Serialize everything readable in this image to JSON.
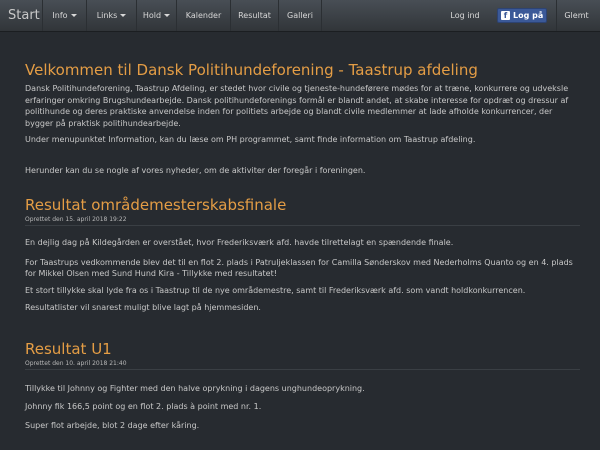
{
  "nav": {
    "brand": "Start",
    "items": [
      {
        "label": "Info",
        "dropdown": true
      },
      {
        "label": "Links",
        "dropdown": true
      },
      {
        "label": "Hold",
        "dropdown": true
      },
      {
        "label": "Kalender",
        "dropdown": false
      },
      {
        "label": "Resultat",
        "dropdown": false
      },
      {
        "label": "Galleri",
        "dropdown": false
      }
    ],
    "login": "Log ind",
    "facebook_login": "Log på",
    "forgot": "Glemt"
  },
  "welcome": {
    "title": "Velkommen til Dansk Politihundeforening - Taastrup afdeling",
    "paragraphs": [
      "Dansk Politihundeforening, Taastrup Afdeling, er stedet hvor civile og tjeneste-hundeførere mødes for at træne, konkurrere og udveksle erfaringer omkring Brugshundearbejde. Dansk politihundeforenings formål er blandt andet, at skabe interesse for opdræt og dressur af politihunde og deres praktiske anvendelse inden for politiets arbejde og blandt civile medlemmer at lade afholde konkurrencer, der bygger på praktisk politihundearbejde.",
      "Under menupunktet Information, kan du læse om PH programmet, samt finde information om Taastrup afdeling.",
      "Herunder kan du se nogle af vores nyheder, om de aktiviter der foregår i foreningen."
    ]
  },
  "posts": [
    {
      "title": "Resultat områdemesterskabsfinale",
      "meta": "Oprettet den 15. april 2018 19:22",
      "paragraphs": [
        "En dejlig dag på Kildegården er overstået, hvor Frederiksværk afd. havde tilrettelagt en spændende finale.",
        "For Taastrups vedkommende blev det til en flot 2. plads i Patruljeklassen for Camilla Sønderskov med Nederholms Quanto og en 4. plads for Mikkel Olsen med Sund Hund Kira - Tillykke med resultatet!",
        "Et stort tillykke skal lyde fra os i Taastrup til de nye områdemestre, samt til Frederiksværk afd. som vandt holdkonkurrencen.",
        "Resultatlister vil snarest muligt blive lagt på hjemmesiden."
      ]
    },
    {
      "title": "Resultat U1",
      "meta": "Oprettet den 10. april 2018 21:40",
      "paragraphs": [
        "Tillykke til Johnny og Fighter med den halve oprykning i dagens unghundeoprykning.",
        "Johnny fik 166,5 point og en flot 2. plads à point med nr. 1.",
        "Super flot arbejde, blot 2 dage efter kåring."
      ]
    }
  ],
  "colors": {
    "background": "#272b30",
    "heading": "#e49d45",
    "text": "#c8c8c8",
    "navbar": "#3a3f44",
    "facebook": "#3b5998"
  }
}
